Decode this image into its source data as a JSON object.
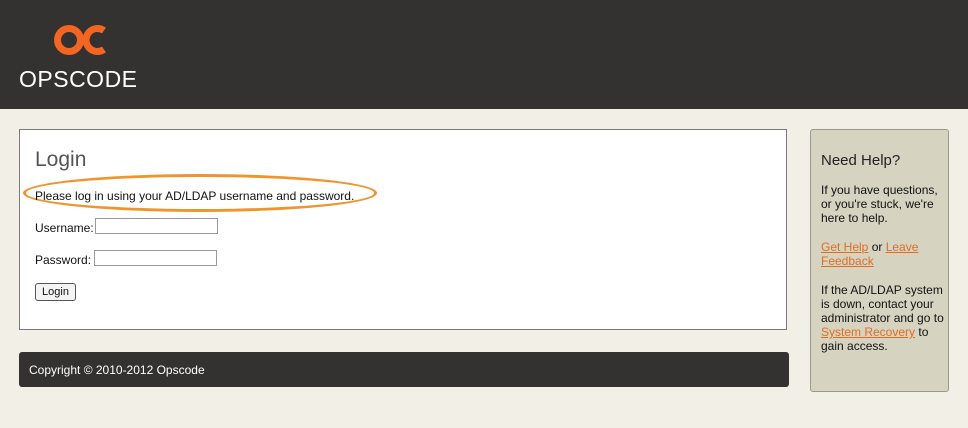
{
  "header": {
    "logo_text": "OPSCODE",
    "brand_color": "#f26522"
  },
  "login": {
    "title": "Login",
    "instructions": "Please log in using your AD/LDAP username and password.",
    "username_label": "Username:",
    "username_value": "",
    "password_label": "Password:",
    "password_value": "",
    "button_label": "Login"
  },
  "footer": {
    "copyright": "Copyright © 2010-2012 Opscode"
  },
  "help": {
    "title": "Need Help?",
    "p1": "If you have questions, or you're stuck, we're here to help.",
    "get_help_link": "Get Help",
    "or_text": " or ",
    "feedback_link": "Leave Feedback",
    "p3_before": "If the AD/LDAP system is down, contact your administrator and go to ",
    "recovery_link": "System Recovery",
    "p3_after": " to gain access.",
    "link_color": "#e26d21"
  },
  "annotation": {
    "highlight_color": "#f0952e"
  }
}
